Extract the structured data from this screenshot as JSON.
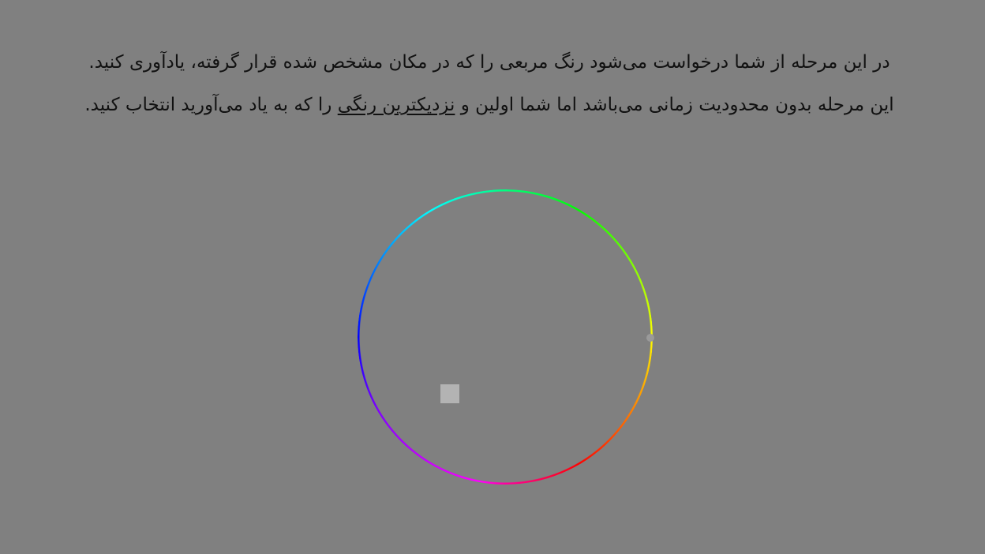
{
  "instructions": {
    "line1": "در این مرحله از شما درخواست می‌شود رنگ مربعی را که در مکان مشخص شده قرار گرفته، یادآوری کنید.",
    "line2_before": "این مرحله بدون محدودیت زمانی می‌باشد اما شما اولین و ",
    "line2_emphasis": "نزدیکترین رنگی",
    "line2_after": " را که به یاد می‌آورید انتخاب کنید."
  },
  "colors": {
    "background": "#808080",
    "text": "#111111",
    "target_square": "#b3b3b3",
    "selector_handle": "#9a9a9a"
  },
  "color_wheel": {
    "type": "hue-ring",
    "hues": [
      "yellow",
      "orange",
      "red",
      "magenta",
      "violet",
      "blue",
      "cyan",
      "green",
      "lime"
    ]
  }
}
